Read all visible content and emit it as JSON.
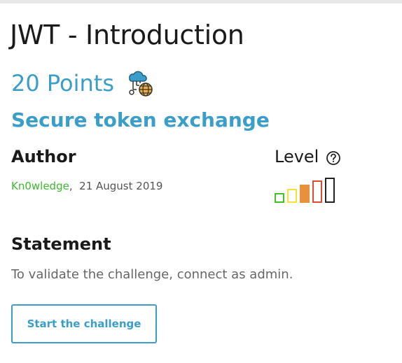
{
  "challenge": {
    "title": "JWT - Introduction",
    "points": "20 Points",
    "subtitle": "Secure token exchange",
    "category_icon": "cloud-network-globe-icon"
  },
  "author": {
    "heading": "Author",
    "name": "Kn0wledge",
    "separator": ",",
    "date": "21 August 2019"
  },
  "level": {
    "heading": "Level",
    "help_icon": "question-circle-icon",
    "current": 3,
    "max": 5,
    "colors": [
      "#44c424",
      "#f0e43a",
      "#e8913a",
      "#de4a34",
      "#222222"
    ]
  },
  "statement": {
    "heading": "Statement",
    "text": "To validate the challenge, connect as admin."
  },
  "actions": {
    "start_label": "Start the challenge"
  },
  "colors": {
    "accent": "#3b9ec9",
    "author_link": "#3cbb2e"
  }
}
